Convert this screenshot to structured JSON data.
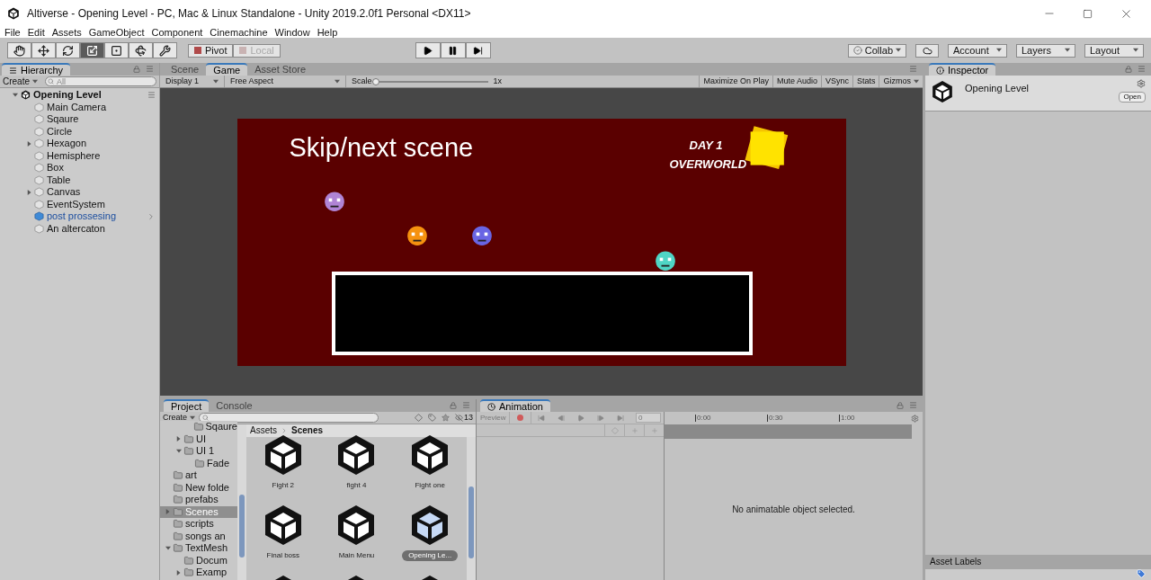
{
  "window": {
    "title": "Altiverse - Opening Level - PC, Mac & Linux Standalone - Unity 2019.2.0f1 Personal <DX11>"
  },
  "menu": [
    "File",
    "Edit",
    "Assets",
    "GameObject",
    "Component",
    "Cinemachine",
    "Window",
    "Help"
  ],
  "toolbar": {
    "tools": [
      {
        "selected": false
      },
      {
        "selected": false
      },
      {
        "selected": false
      },
      {
        "selected": true
      },
      {
        "selected": false
      },
      {
        "selected": false
      },
      {
        "selected": false
      }
    ],
    "handle_modes": [
      {
        "label": "Pivot",
        "disabled": false
      },
      {
        "label": "Local",
        "disabled": true
      }
    ],
    "collab": "Collab",
    "account": "Account",
    "layers": "Layers",
    "layout": "Layout"
  },
  "hierarchy": {
    "tab": "Hierarchy",
    "create": "Create",
    "search_placeholder": "All",
    "scene": {
      "label": "Opening Level",
      "expanded": true,
      "children": [
        {
          "label": "Main Camera",
          "kind": "object"
        },
        {
          "label": "Sqaure",
          "kind": "object"
        },
        {
          "label": "Circle",
          "kind": "object"
        },
        {
          "label": "Hexagon",
          "kind": "object",
          "expanded": false
        },
        {
          "label": "Hemisphere",
          "kind": "object"
        },
        {
          "label": "Box",
          "kind": "object"
        },
        {
          "label": "Table",
          "kind": "object"
        },
        {
          "label": "Canvas",
          "kind": "object",
          "expanded": false
        },
        {
          "label": "EventSystem",
          "kind": "object"
        },
        {
          "label": "post prossesing",
          "kind": "prefab"
        },
        {
          "label": "An altercaton",
          "kind": "object"
        }
      ]
    }
  },
  "game": {
    "tabs": [
      {
        "label": "Scene",
        "selected": false
      },
      {
        "label": "Game",
        "selected": true
      },
      {
        "label": "Asset Store",
        "selected": false
      }
    ],
    "display": "Display 1",
    "aspect": "Free Aspect",
    "scale_label": "Scale",
    "scale": {
      "level": 0,
      "reading": "1x"
    },
    "toggles": [
      {
        "label": "Maximize On Play",
        "on": false
      },
      {
        "label": "Mute Audio",
        "on": false
      },
      {
        "label": "VSync",
        "on": false
      },
      {
        "label": "Stats",
        "on": false
      },
      {
        "label": "Gizmos",
        "on": false
      }
    ],
    "screen": {
      "prompt": "Skip/next scene",
      "day": "DAY 1",
      "location": "OVERWORLD"
    }
  },
  "project": {
    "tabs": [
      {
        "label": "Project",
        "selected": true
      },
      {
        "label": "Console",
        "selected": false
      }
    ],
    "create": "Create",
    "filter_count": "13",
    "tree": [
      {
        "children": [
          {
            "children": [
              {
                "label": "Sqaure",
                "selected": false
              }
            ]
          },
          {
            "label": "UI",
            "selected": false,
            "expanded": false
          },
          {
            "label": "UI 1",
            "selected": false,
            "expanded": true,
            "children": [
              {
                "label": "Fade",
                "selected": false
              }
            ]
          }
        ]
      },
      {
        "label": "art",
        "selected": false
      },
      {
        "label": "New folde",
        "selected": false
      },
      {
        "label": "prefabs",
        "selected": false
      },
      {
        "label": "Scenes",
        "selected": true,
        "expanded": false
      },
      {
        "label": "scripts",
        "selected": false
      },
      {
        "label": "songs an",
        "selected": false
      },
      {
        "label": "TextMesh",
        "selected": false,
        "expanded": true,
        "children": [
          {
            "label": "Docum",
            "selected": false
          },
          {
            "label": "Examp",
            "selected": false,
            "expanded": false
          }
        ]
      }
    ],
    "breadcrumb": [
      "Assets",
      "Scenes"
    ],
    "assets": [
      {
        "label": "Fight 2",
        "selected": false
      },
      {
        "label": "fight 4",
        "selected": false
      },
      {
        "label": "Fight one",
        "selected": false
      },
      {
        "label": "Final boss",
        "selected": false
      },
      {
        "label": "Main Menu",
        "selected": false
      },
      {
        "label": "Opening Le...",
        "selected": true
      }
    ]
  },
  "animation": {
    "tab": "Animation",
    "preview": "Preview",
    "frame": "0",
    "ticks": [
      "0:00",
      "0:30",
      "1:00"
    ],
    "message": "No animatable object selected."
  },
  "inspector": {
    "tab": "Inspector",
    "title": "Opening Level",
    "open": "Open",
    "labels": "Asset Labels"
  }
}
